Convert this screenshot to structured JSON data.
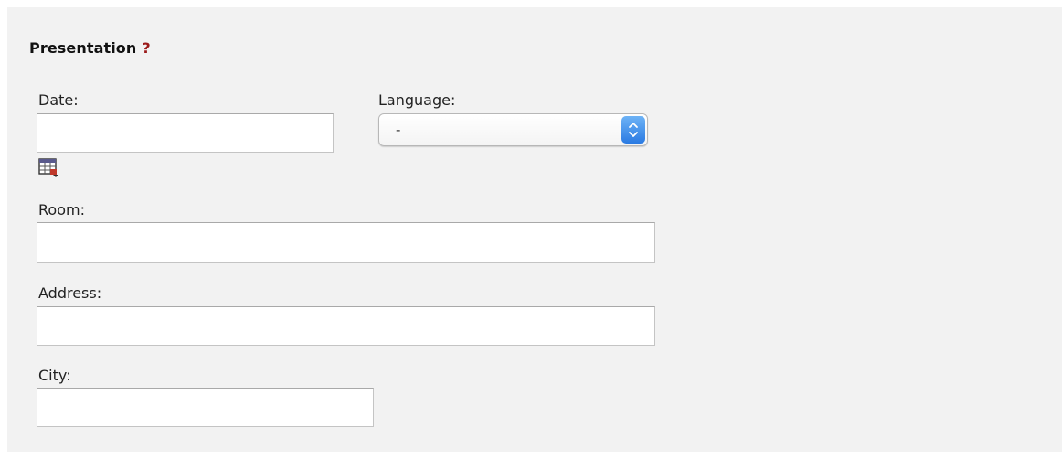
{
  "section": {
    "title": "Presentation",
    "help": "?"
  },
  "date": {
    "label": "Date:",
    "value": ""
  },
  "language": {
    "label": "Language:",
    "selected": "-"
  },
  "room": {
    "label": "Room:",
    "value": ""
  },
  "address": {
    "label": "Address:",
    "value": ""
  },
  "city": {
    "label": "City:",
    "value": ""
  },
  "icons": {
    "calendar": "calendar-icon",
    "select_arrows": "chevron-updown-icon",
    "help": "help-icon"
  },
  "colors": {
    "panel_background": "#f2f2f2",
    "help_mark": "#9b1b1b",
    "select_accent": "#2a7ae2"
  }
}
